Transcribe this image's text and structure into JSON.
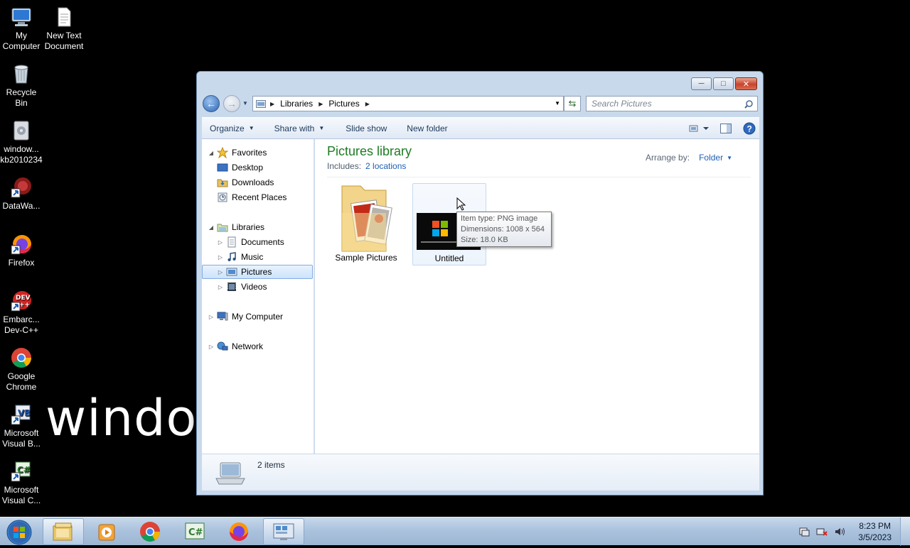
{
  "desktop": {
    "icons": [
      {
        "label": "My\nComputer"
      },
      {
        "label": "New Text\nDocument"
      },
      {
        "label": "Recycle\nBin"
      },
      {
        "label": "window...\nkb2010234"
      },
      {
        "label": "DataWa..."
      },
      {
        "label": "Firefox"
      },
      {
        "label": "Embarc...\nDev-C++"
      },
      {
        "label": "Google\nChrome"
      },
      {
        "label": "Microsoft\nVisual B..."
      },
      {
        "label": "Microsoft\nVisual C..."
      }
    ],
    "wallpaper_text": "windows"
  },
  "window": {
    "address": {
      "crumbs": [
        "Libraries",
        "Pictures"
      ]
    },
    "search": {
      "placeholder": "Search Pictures"
    },
    "toolbar": {
      "organize": "Organize",
      "share_with": "Share with",
      "slide_show": "Slide show",
      "new_folder": "New folder"
    },
    "nav": {
      "favorites": "Favorites",
      "desktop": "Desktop",
      "downloads": "Downloads",
      "recent_places": "Recent Places",
      "libraries": "Libraries",
      "documents": "Documents",
      "music": "Music",
      "pictures": "Pictures",
      "videos": "Videos",
      "my_computer": "My Computer",
      "network": "Network"
    },
    "content": {
      "title": "Pictures library",
      "includes_label": "Includes:",
      "includes_link": "2 locations",
      "arrange_label": "Arrange by:",
      "arrange_value": "Folder",
      "items": [
        {
          "name": "Sample Pictures"
        },
        {
          "name": "Untitled"
        }
      ]
    },
    "tooltip": {
      "type": "Item type: PNG image",
      "dimensions": "Dimensions: 1008 x 564",
      "size": "Size: 18.0 KB"
    },
    "details": {
      "count": "2 items"
    }
  },
  "taskbar": {
    "time": "8:23 PM",
    "date": "3/5/2023"
  },
  "colors": {
    "library_title": "#1e7b24",
    "link": "#1e5fb5",
    "selection": "#cde3fb"
  }
}
